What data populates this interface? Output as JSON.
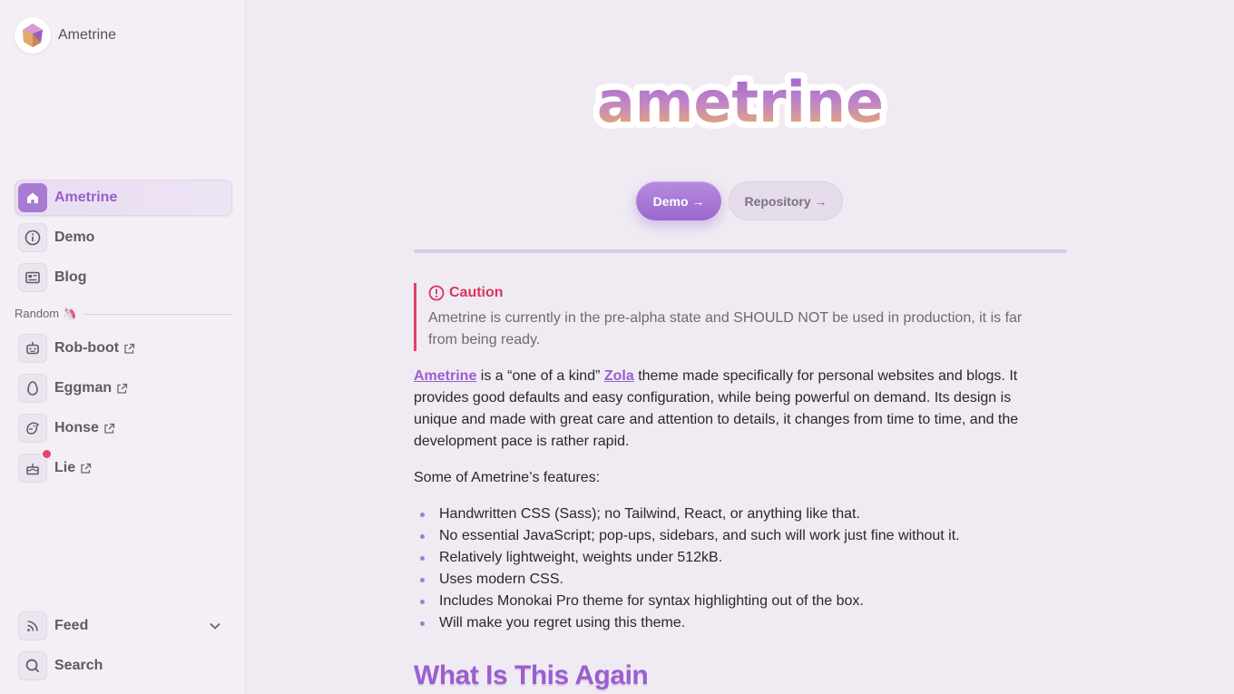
{
  "brand": {
    "name": "Ametrine"
  },
  "nav": {
    "primary": [
      {
        "label": "Ametrine",
        "icon": "home-icon",
        "active": true
      },
      {
        "label": "Demo",
        "icon": "info-icon"
      },
      {
        "label": "Blog",
        "icon": "newspaper-icon"
      }
    ],
    "random_label": "Random",
    "random_emoji": "🦄",
    "random": [
      {
        "label": "Rob-boot",
        "icon": "robot-icon"
      },
      {
        "label": "Eggman",
        "icon": "egg-icon"
      },
      {
        "label": "Honse",
        "icon": "horse-icon"
      },
      {
        "label": "Lie",
        "icon": "cake-icon",
        "badge": true
      }
    ],
    "bottom": [
      {
        "label": "Feed",
        "icon": "rss-icon"
      },
      {
        "label": "Search",
        "icon": "search-icon"
      }
    ]
  },
  "hero": {
    "logo_text": "ametrine",
    "buttons": {
      "primary": "Demo →",
      "secondary": "Repository →"
    }
  },
  "callout": {
    "title": "Caution",
    "text": "Ametrine is currently in the pre-alpha state and SHOULD NOT be used in production, it is far from being ready."
  },
  "intro": {
    "link1": "Ametrine",
    "mid1": " is a “one of a kind” ",
    "link2": "Zola",
    "rest": " theme made specifically for personal websites and blogs. It provides good defaults and easy configuration, while being powerful on demand. Its design is unique and made with great care and attention to details, it changes from time to time, and the development pace is rather rapid."
  },
  "features_intro": "Some of Ametrine’s features:",
  "features": [
    "Handwritten CSS (Sass); no Tailwind, React, or anything like that.",
    "No essential JavaScript; pop-ups, sidebars, and such will work just fine without it.",
    "Relatively lightweight, weights under 512kB.",
    "Uses modern CSS.",
    "Includes Monokai Pro theme for syntax highlighting out of the box.",
    "Will make you regret using this theme."
  ],
  "section_heading": "What Is This Again",
  "colors": {
    "accent": "#9a5fcf",
    "caution": "#e0426a",
    "background": "#f0ebf3"
  }
}
